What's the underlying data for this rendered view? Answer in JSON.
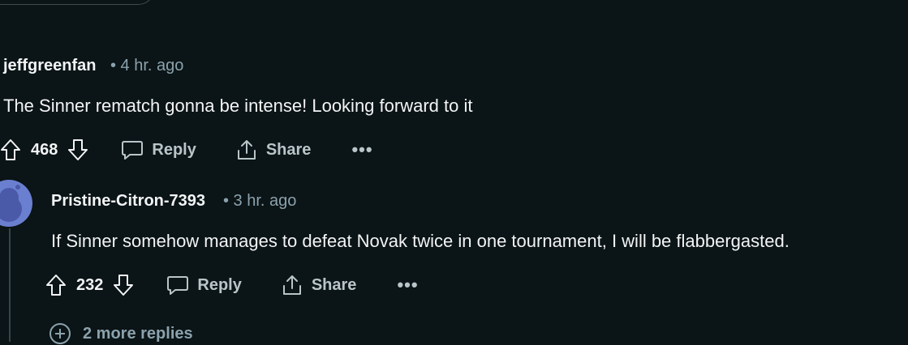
{
  "comment": {
    "author": "jeffgreenfan",
    "time": "• 4 hr. ago",
    "text": "The Sinner rematch gonna be intense! Looking forward to it",
    "votes": "468",
    "reply_label": "Reply",
    "share_label": "Share",
    "more_label": "•••"
  },
  "reply": {
    "author": "Pristine-Citron-7393",
    "time": "• 3 hr. ago",
    "text": "If Sinner somehow manages to defeat Novak twice in one tournament, I will be flabbergasted.",
    "votes": "232",
    "reply_label": "Reply",
    "share_label": "Share",
    "more_label": "•••"
  },
  "more_replies": "2 more replies",
  "colors": {
    "background": "#0b1416",
    "text": "#f2f4f5",
    "muted": "#8ba2ad",
    "avatar": "#6a7fd0"
  }
}
